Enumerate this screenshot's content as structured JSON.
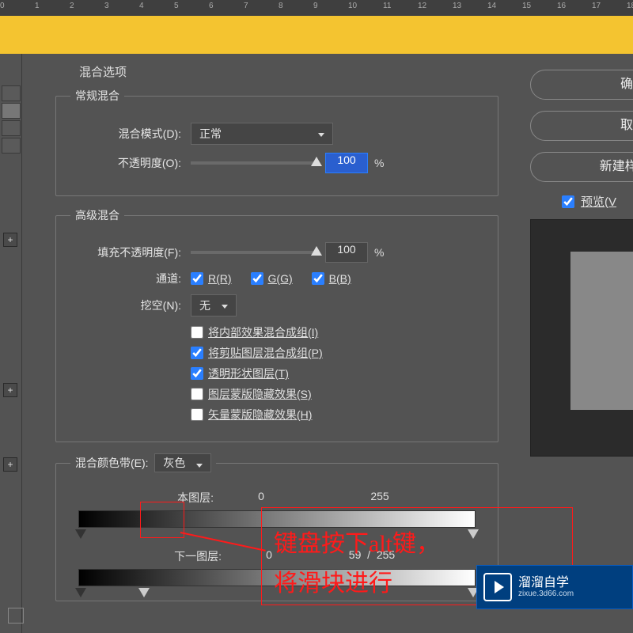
{
  "ruler_ticks": [
    "0",
    "1",
    "2",
    "3",
    "4",
    "5",
    "6",
    "7",
    "8",
    "9",
    "10",
    "11",
    "12",
    "13",
    "14",
    "15",
    "16",
    "17",
    "18"
  ],
  "panel_title": "混合选项",
  "normal": {
    "legend": "常规混合",
    "mode_label": "混合模式(D):",
    "mode_value": "正常",
    "opacity_label": "不透明度(O):",
    "opacity_value": "100",
    "pct": "%"
  },
  "advanced": {
    "legend": "高级混合",
    "fill_label": "填充不透明度(F):",
    "fill_value": "100",
    "pct": "%",
    "channels_label": "通道:",
    "r_label": "R(R)",
    "g_label": "G(G)",
    "b_label": "B(B)",
    "knockout_label": "挖空(N):",
    "knockout_value": "无",
    "opts": [
      {
        "label": "将内部效果混合成组(I)",
        "checked": false
      },
      {
        "label": "将剪贴图层混合成组(P)",
        "checked": true
      },
      {
        "label": "透明形状图层(T)",
        "checked": true
      },
      {
        "label": "图层蒙版隐藏效果(S)",
        "checked": false
      },
      {
        "label": "矢量蒙版隐藏效果(H)",
        "checked": false
      }
    ]
  },
  "blendif": {
    "legend": "混合颜色带(E):",
    "gray": "灰色",
    "this_label": "本图层:",
    "this_lo": "0",
    "this_hi": "255",
    "under_label": "下一图层:",
    "under_lo": "0",
    "under_mid": "59",
    "under_sep": "/",
    "under_hi": "255"
  },
  "buttons": {
    "ok": "确定",
    "cancel": "取消",
    "new_style": "新建样式(W",
    "preview": "预览(V"
  },
  "annotation": {
    "line1": "键盘按下alt键，",
    "line2": "将滑块进行"
  },
  "logo": {
    "title": "溜溜自学",
    "sub": "zixue.3d66.com"
  }
}
